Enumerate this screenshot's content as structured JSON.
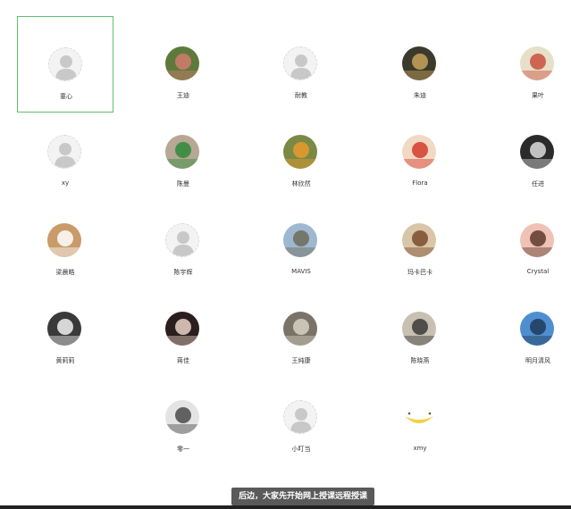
{
  "participants": [
    {
      "name": "童心",
      "avatar": "default-person-icon",
      "selected": true,
      "palette": [
        "#e6e6e6",
        "#c8c8c8"
      ]
    },
    {
      "name": "王迪",
      "avatar": "photo-plush-toy-icon",
      "selected": false,
      "palette": [
        "#5d7a3b",
        "#d27a6e"
      ]
    },
    {
      "name": "耐教",
      "avatar": "default-person-icon",
      "selected": false,
      "palette": [
        "#e6e6e6",
        "#c8c8c8"
      ]
    },
    {
      "name": "朱迪",
      "avatar": "photo-street-icon",
      "selected": false,
      "palette": [
        "#3c3a2c",
        "#c8a35a"
      ]
    },
    {
      "name": "果叶",
      "avatar": "photo-flowers-icon",
      "selected": false,
      "palette": [
        "#e7e0c8",
        "#c94f3e"
      ]
    },
    {
      "name": "xy",
      "avatar": "default-person-icon",
      "selected": false,
      "palette": [
        "#e6e6e6",
        "#c8c8c8"
      ]
    },
    {
      "name": "陈曼",
      "avatar": "photo-green-bag-icon",
      "selected": false,
      "palette": [
        "#b6a894",
        "#2f8a3a"
      ]
    },
    {
      "name": "林欣然",
      "avatar": "photo-sunset-icon",
      "selected": false,
      "palette": [
        "#7a8a45",
        "#e89a2c"
      ]
    },
    {
      "name": "Flora",
      "avatar": "photo-cartoon-icon",
      "selected": false,
      "palette": [
        "#f2d9c4",
        "#d33b2c"
      ]
    },
    {
      "name": "任进",
      "avatar": "photo-dark-scene-icon",
      "selected": false,
      "palette": [
        "#2b2b2b",
        "#dcdcdc"
      ]
    },
    {
      "name": "梁晨皓",
      "avatar": "photo-corgi-icon",
      "selected": false,
      "palette": [
        "#c99a6a",
        "#ffffff"
      ]
    },
    {
      "name": "陈宇辉",
      "avatar": "default-person-icon",
      "selected": false,
      "palette": [
        "#e6e6e6",
        "#c8c8c8"
      ]
    },
    {
      "name": "MAVIS",
      "avatar": "photo-tree-icon",
      "selected": false,
      "palette": [
        "#9eb8cf",
        "#6b6b5a"
      ]
    },
    {
      "name": "玛卡巴卡",
      "avatar": "photo-autumn-icon",
      "selected": false,
      "palette": [
        "#d9c6a8",
        "#7a4a2a"
      ]
    },
    {
      "name": "Crystal",
      "avatar": "photo-portrait-icon",
      "selected": false,
      "palette": [
        "#f0c2b6",
        "#5a3a2a"
      ]
    },
    {
      "name": "黄莉莉",
      "avatar": "photo-woman-icon",
      "selected": false,
      "palette": [
        "#3a3a3a",
        "#f2f2f2"
      ]
    },
    {
      "name": "蒋佳",
      "avatar": "photo-woman-suit-icon",
      "selected": false,
      "palette": [
        "#2a1e1e",
        "#e9d3c6"
      ]
    },
    {
      "name": "王纯康",
      "avatar": "photo-cat-icon",
      "selected": false,
      "palette": [
        "#7a7468",
        "#d8d2c4"
      ]
    },
    {
      "name": "陈晓燕",
      "avatar": "photo-street-person-icon",
      "selected": false,
      "palette": [
        "#c8c0b0",
        "#3a3a3a"
      ]
    },
    {
      "name": "明月清风",
      "avatar": "photo-lake-icon",
      "selected": false,
      "palette": [
        "#4f8fd0",
        "#1f3b5a"
      ]
    },
    {
      "name": "零一",
      "avatar": "photo-bw-art-icon",
      "selected": false,
      "palette": [
        "#e4e4e4",
        "#4a4a4a"
      ]
    },
    {
      "name": "小叮当",
      "avatar": "default-person-icon",
      "selected": false,
      "palette": [
        "#e6e6e6",
        "#c8c8c8"
      ]
    },
    {
      "name": "xmy",
      "avatar": "photo-banana-icon",
      "selected": false,
      "palette": [
        "#ffffff",
        "#f2d04a"
      ]
    }
  ],
  "caption": "后边，大家先开始网上授课远程授课",
  "colors": {
    "selected_border": "#5fbf6e",
    "caption_bg": "#5a5a5a",
    "caption_text": "#ffffff",
    "name_text": "#333333"
  }
}
